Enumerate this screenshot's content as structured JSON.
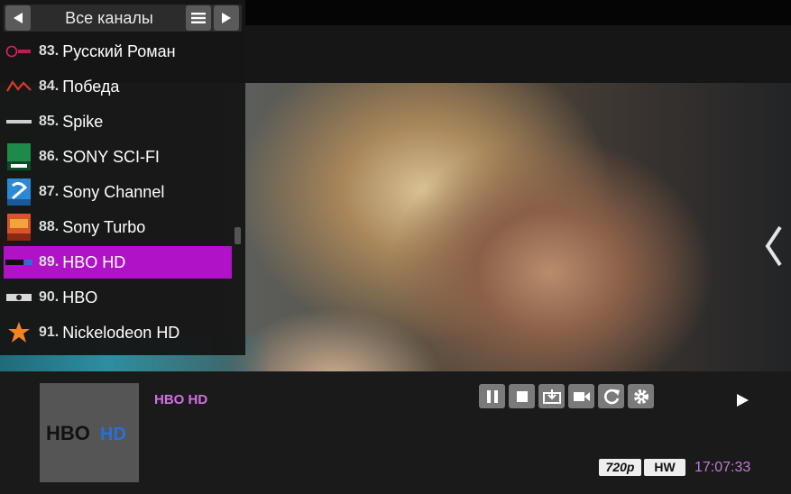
{
  "panel": {
    "title": "Все каналы"
  },
  "channels": [
    {
      "num": "83.",
      "name": "Русский Роман",
      "logo": "ru-roman-logo",
      "selected": false
    },
    {
      "num": "84.",
      "name": "Победа",
      "logo": "pobeda-logo",
      "selected": false
    },
    {
      "num": "85.",
      "name": "Spike",
      "logo": "spike-logo",
      "selected": false
    },
    {
      "num": "86.",
      "name": "SONY SCI-FI",
      "logo": "sony-scifi-logo",
      "selected": false
    },
    {
      "num": "87.",
      "name": "Sony Channel",
      "logo": "sony-channel-logo",
      "selected": false
    },
    {
      "num": "88.",
      "name": "Sony Turbo",
      "logo": "sony-turbo-logo",
      "selected": false
    },
    {
      "num": "89.",
      "name": "HBO HD",
      "logo": "hbo-hd-logo",
      "selected": true
    },
    {
      "num": "90.",
      "name": "HBO",
      "logo": "hbo-logo",
      "selected": false
    },
    {
      "num": "91.",
      "name": "Nickelodeon HD",
      "logo": "nick-logo",
      "selected": false
    }
  ],
  "now_playing": {
    "title": "HBO HD",
    "thumb_logo_text": "HBO",
    "thumb_logo_hd": "HD"
  },
  "status": {
    "resolution": "720p",
    "decoder": "HW",
    "time": "17:07:33"
  },
  "colors": {
    "selected_row": "#b012c8",
    "title_accent": "#d46ee6",
    "clock": "#c37ad8"
  }
}
